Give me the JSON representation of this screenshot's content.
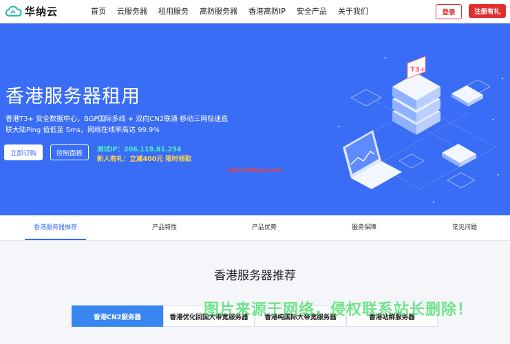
{
  "nav": {
    "logo_text": "华纳云",
    "items": [
      "首页",
      "云服务器",
      "租用服务",
      "高防服务器",
      "香港高防IP",
      "安全产品",
      "关于我们"
    ],
    "login_label": "登录",
    "register_label": "注册有礼"
  },
  "hero": {
    "title": "香港服务器租用",
    "desc_line1": "香港T3+ 安全数据中心，BGP国际多线 + 双向CN2联通 移动三网极速直",
    "desc_line2": "联大陆Ping 值低至 5ms，网络在线率高达 99.9%",
    "subscribe_label": "立即订购",
    "panel_label": "控制面板",
    "test_ip": "测试IP：206.119.81.254",
    "promo": "新人有礼：立减400元 限时领取",
    "watermark_url": "www.ittellyou.com",
    "illustration_badge": "T3+"
  },
  "tabs": [
    "香港服务器推荐",
    "产品特性",
    "产品优势",
    "服务保障",
    "常见问题"
  ],
  "active_tab": "香港服务器推荐",
  "section": {
    "title": "香港服务器推荐",
    "sub_tabs": [
      "香港CN2服务器",
      "香港优化回国大带宽服务器",
      "香港纯国际大带宽服务器",
      "香港站群服务器"
    ]
  },
  "overlay_watermark": "图片来源于网络，侵权联系站长删除！",
  "colors": {
    "brand_blue": "#3a6df5",
    "accent_red": "#e02e2e",
    "test_ip_green": "#4ef0c5",
    "promo_yellow": "#ffd54a"
  }
}
